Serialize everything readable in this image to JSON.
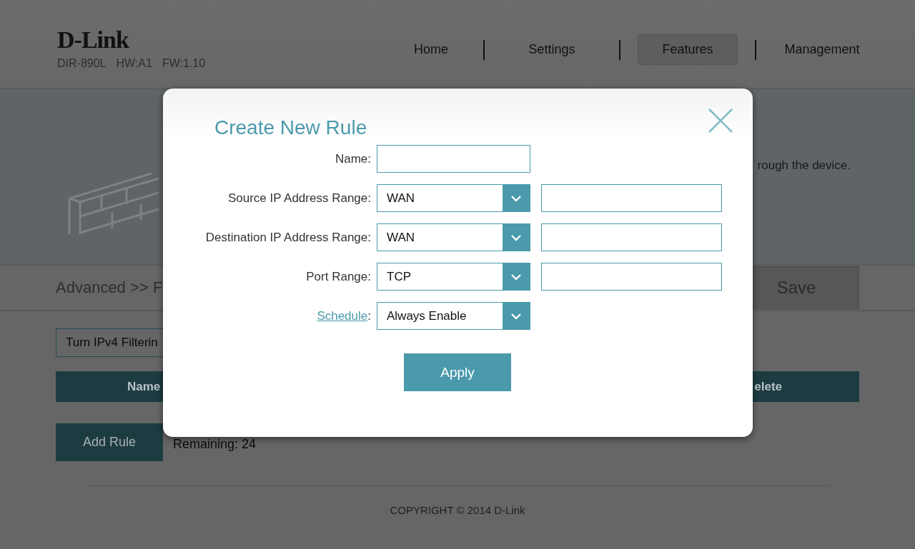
{
  "header": {
    "logo": "D-Link",
    "model": "DIR-890L",
    "hw": "HW:A1",
    "fw": "FW:1.10"
  },
  "nav": [
    {
      "label": "Home",
      "selected": false
    },
    {
      "label": "Settings",
      "selected": false
    },
    {
      "label": "Features",
      "selected": true
    },
    {
      "label": "Management",
      "selected": false
    }
  ],
  "banner": {
    "description": "rough the device."
  },
  "toolbar": {
    "breadcrumb": "Advanced >> F",
    "save_button": "Save"
  },
  "filter_select": {
    "value": "Turn IPv4 Filterin"
  },
  "table": {
    "columns": [
      "Name",
      "elete"
    ]
  },
  "add_rule_button": "Add Rule",
  "remaining": "Remaining: 24",
  "footer": {
    "copyright": "COPYRIGHT © 2014 D-Link"
  },
  "dialog": {
    "title": "Create New Rule",
    "fields": [
      {
        "kind": "text",
        "label": "Name:"
      },
      {
        "kind": "select_range",
        "label": "Source IP Address Range:",
        "value": "WAN"
      },
      {
        "kind": "select_range",
        "label": "Destination IP Address Range:",
        "value": "WAN"
      },
      {
        "kind": "select_range",
        "label": "Port Range:",
        "value": "TCP"
      },
      {
        "kind": "select",
        "label": "Schedule",
        "label_is_link": true,
        "label_suffix": ":",
        "value": "Always Enable"
      }
    ],
    "apply_button": "Apply"
  }
}
